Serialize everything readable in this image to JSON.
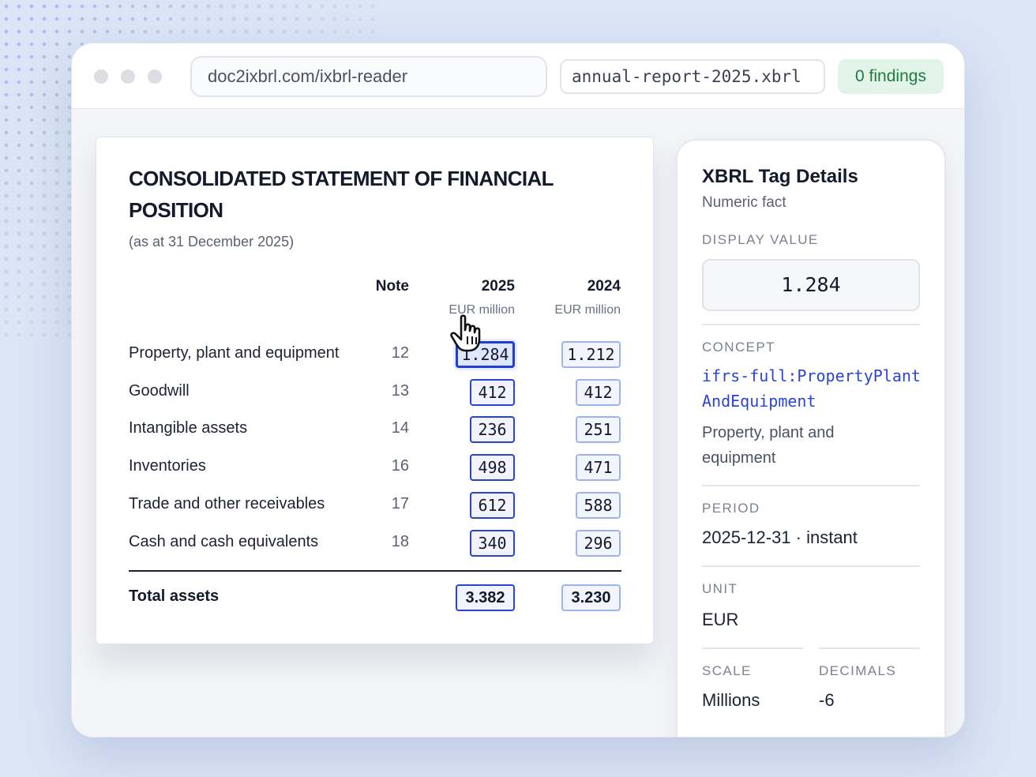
{
  "browser": {
    "url": "doc2ixbrl.com/ixbrl-reader",
    "file_name": "annual-report-2025.xbrl",
    "findings": "0 findings"
  },
  "statement": {
    "title": "CONSOLIDATED STATEMENT OF FINANCIAL POSITION",
    "subtitle": "(as at 31 December 2025)",
    "columns": {
      "note": "Note",
      "year_current": "2025",
      "year_prior": "2024",
      "unit_current": "EUR million",
      "unit_prior": "EUR million"
    },
    "rows": [
      {
        "label": "Property, plant and equipment",
        "note": "12",
        "v2025": "1.284",
        "v2024": "1.212"
      },
      {
        "label": "Goodwill",
        "note": "13",
        "v2025": "412",
        "v2024": "412"
      },
      {
        "label": "Intangible assets",
        "note": "14",
        "v2025": "236",
        "v2024": "251"
      },
      {
        "label": "Inventories",
        "note": "16",
        "v2025": "498",
        "v2024": "471"
      },
      {
        "label": "Trade and other receivables",
        "note": "17",
        "v2025": "612",
        "v2024": "588"
      },
      {
        "label": "Cash and cash equivalents",
        "note": "18",
        "v2025": "340",
        "v2024": "296"
      }
    ],
    "total": {
      "label": "Total assets",
      "v2025": "3.382",
      "v2024": "3.230"
    }
  },
  "details": {
    "title": "XBRL Tag Details",
    "subtitle": "Numeric fact",
    "display_value_label": "DISPLAY VALUE",
    "display_value": "1.284",
    "concept_label": "CONCEPT",
    "concept": "ifrs-full:PropertyPlantAndEquipment",
    "concept_desc": "Property, plant and equipment",
    "period_label": "PERIOD",
    "period": "2025-12-31 · instant",
    "unit_label": "UNIT",
    "unit": "EUR",
    "scale_label": "SCALE",
    "scale": "Millions",
    "decimals_label": "DECIMALS",
    "decimals": "-6"
  },
  "colors": {
    "accent": "#2744d6",
    "accent_light": "#9fb2ee",
    "findings_bg": "#e2f4e8",
    "findings_text": "#1f7a45"
  }
}
